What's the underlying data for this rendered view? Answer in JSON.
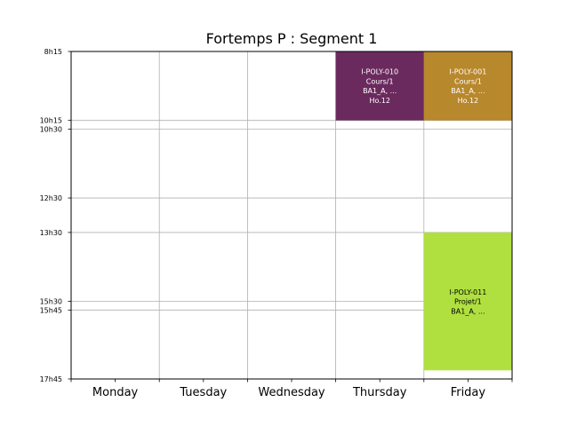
{
  "chart_data": {
    "type": "timetable",
    "title": "Fortemps P : Segment 1",
    "days": [
      "Monday",
      "Tuesday",
      "Wednesday",
      "Thursday",
      "Friday"
    ],
    "time_ticks": [
      {
        "label": "8h15",
        "minutes": 495
      },
      {
        "label": "10h15",
        "minutes": 615
      },
      {
        "label": "10h30",
        "minutes": 630
      },
      {
        "label": "12h30",
        "minutes": 750
      },
      {
        "label": "13h30",
        "minutes": 810
      },
      {
        "label": "15h30",
        "minutes": 930
      },
      {
        "label": "15h45",
        "minutes": 945
      },
      {
        "label": "17h45",
        "minutes": 1065
      }
    ],
    "ylim_minutes": [
      495,
      1065
    ],
    "grid": true,
    "events": [
      {
        "day": "Thursday",
        "start": "8h15",
        "end": "10h15",
        "lines": [
          "I-POLY-010",
          "Cours/1",
          "BA1_A, ...",
          "Ho.12"
        ],
        "color": "#6b2a5e",
        "text_color": "#ffffff"
      },
      {
        "day": "Friday",
        "start": "8h15",
        "end": "10h15",
        "lines": [
          "I-POLY-001",
          "Cours/1",
          "BA1_A, ...",
          "Ho.12"
        ],
        "color": "#b8882c",
        "text_color": "#ffffff"
      },
      {
        "day": "Friday",
        "start": "13h30",
        "end": "17h30",
        "lines": [
          "I-POLY-011",
          "Projet/1",
          "BA1_A, ..."
        ],
        "color": "#b0e040",
        "text_color": "#000000"
      }
    ]
  }
}
